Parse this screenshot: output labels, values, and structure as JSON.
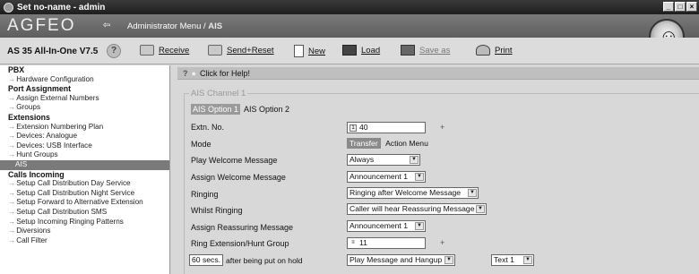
{
  "window": {
    "title": "Set no-name - admin",
    "buttons": [
      "_",
      "□",
      "×"
    ]
  },
  "banner": {
    "logo": "AGFEO",
    "breadcrumb_parent": "Administrator Menu",
    "breadcrumb_sep": " / ",
    "breadcrumb_current": "AIS"
  },
  "toolbar": {
    "product": "AS 35 All-In-One V7.5",
    "help_glyph": "?",
    "receive": "Receive",
    "send_reset": "Send+Reset",
    "new": "New",
    "load": "Load",
    "save_as": "Save as",
    "print": "Print"
  },
  "sidebar": {
    "pbx": "PBX",
    "hardware_configuration": "Hardware Configuration",
    "port_assignment": "Port Assignment",
    "assign_external_numbers": "Assign External Numbers",
    "groups": "Groups",
    "extensions": "Extensions",
    "extension_numbering_plan": "Extension Numbering Plan",
    "devices_analogue": "Devices: Analogue",
    "devices_usb": "Devices: USB Interface",
    "hunt_groups": "Hunt Groups",
    "ais": "AIS",
    "calls_incoming": "Calls Incoming",
    "cd_day": "Setup Call Distribution Day Service",
    "cd_night": "Setup Call Distribution Night Service",
    "forward_alt": "Setup Forward to Alternative Extension",
    "cd_sms": "Setup Call Distribution SMS",
    "ringing_patterns": "Setup Incoming Ringing Patterns",
    "diversions": "Diversions",
    "call_filter": "Call Filter"
  },
  "helpbar": {
    "q": "?",
    "text": "Click for Help!"
  },
  "form": {
    "legend": "AIS Channel 1",
    "tab1": "AIS Option 1",
    "tab2": "AIS Option 2",
    "extn_label": "Extn. No.",
    "extn_value": "40",
    "mode_label": "Mode",
    "mode_transfer": "Transfer",
    "mode_action": "Action Menu",
    "play_welcome_label": "Play Welcome Message",
    "play_welcome_value": "Always",
    "assign_welcome_label": "Assign Welcome Message",
    "assign_welcome_value": "Announcement 1",
    "ringing_label": "Ringing",
    "ringing_value": "Ringing after Welcome Message",
    "whilst_label": "Whilst Ringing",
    "whilst_value": "Caller will hear Reassuring Message",
    "assign_reassuring_label": "Assign Reassuring Message",
    "assign_reassuring_value": "Announcement 1",
    "ring_ext_label": "Ring Extension/Hunt Group",
    "ring_ext_value": "11",
    "hold_secs": "60 secs.",
    "hold_label": "after being put on hold",
    "hold_action_value": "Play Message and Hangup",
    "hold_text_value": "Text 1",
    "plus": "+"
  }
}
